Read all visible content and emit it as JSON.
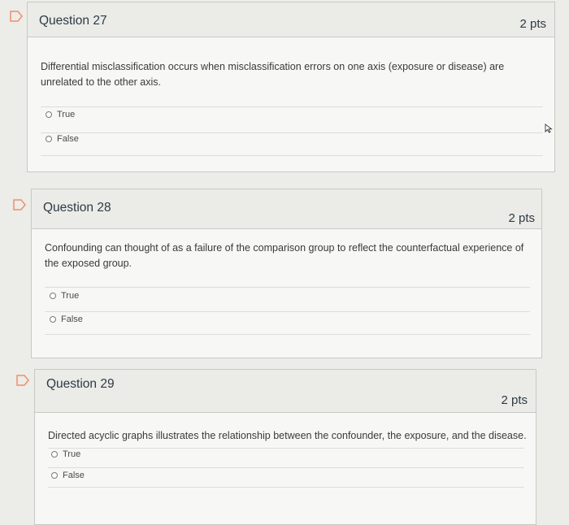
{
  "questions": [
    {
      "title": "Question 27",
      "points": "2 pts",
      "text": "Differential misclassification occurs when misclassification errors on one axis (exposure or disease) are unrelated to the other axis.",
      "answers": [
        "True",
        "False"
      ]
    },
    {
      "title": "Question 28",
      "points": "2 pts",
      "text": "Confounding can thought of as a failure of the comparison group to reflect the counterfactual experience of the exposed group.",
      "answers": [
        "True",
        "False"
      ]
    },
    {
      "title": "Question 29",
      "points": "2 pts",
      "text": "Directed acyclic graphs illustrates the relationship between the confounder, the exposure, and the disease.",
      "answers": [
        "True",
        "False"
      ]
    }
  ],
  "colors": {
    "flag_outline": "#ef8f6a",
    "header_bg": "#ebebe8",
    "body_bg": "#f7f7f5",
    "border": "#c8c8c4"
  },
  "icons": {
    "flag": "bookmark-flag-icon",
    "cursor": "mouse-pointer-icon"
  }
}
